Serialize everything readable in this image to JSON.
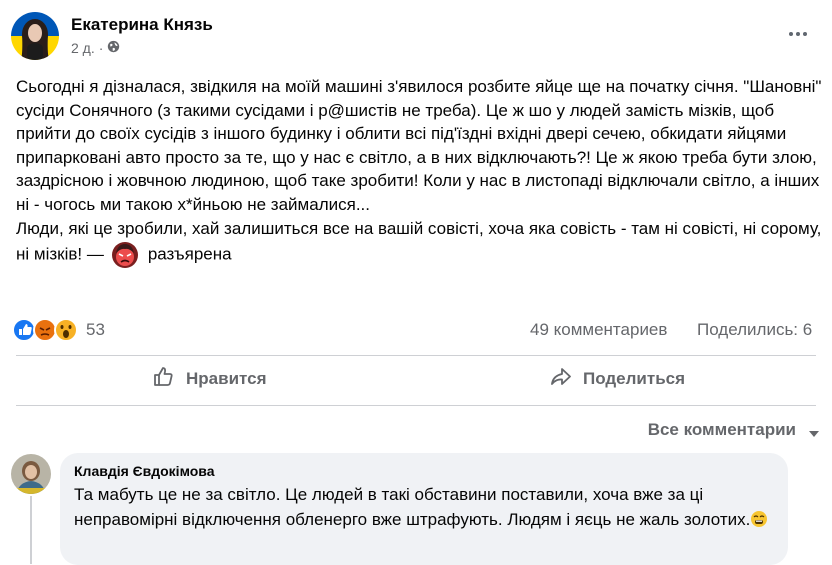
{
  "post": {
    "author": "Екатерина Князь",
    "time": "2 д.",
    "privacy_icon": "globe-icon",
    "more_icon": "more-options-icon",
    "paragraph_1": "Сьогодні я дізналася,  звідкиля на моїй машині з'явилося розбите яйце ще на початку січня. \"Шановні\" сусіди Сонячного (з такими сусідами і р@шистів не треба). Це ж шо у людей замість мізків, щоб прийти до своїх сусідів з іншого будинку і облити всі під'їздні вхідні двері сечею, обкидати яйцями припарковані авто просто за те, що у нас є світло, а в них відключають?! Це ж якою треба бути злою, заздрісною і жовчною людиною, щоб таке зробити! Коли у нас в листопаді відключали світло, а інших ні - чогось ми такою х*йньою не займалися...",
    "paragraph_2_main": "Люди, які це зробили, хай залишиться все на вашій совісті, хоча яка совість - там ні совісті, ні сорому, ні мізків! —",
    "feeling_icon": "angry-face-icon",
    "feeling": "разъярена"
  },
  "reactions": {
    "icons": [
      "like-reaction-icon",
      "angry-reaction-icon",
      "wow-reaction-icon"
    ],
    "count": "53",
    "comments": "49 комментариев",
    "shares": "Поделились: 6"
  },
  "actions": {
    "like_label": "Нравится",
    "like_icon": "thumbs-up-icon",
    "share_label": "Поделиться",
    "share_icon": "share-arrow-icon"
  },
  "comments_section": {
    "sort_label": "Все комментарии",
    "sort_icon": "caret-down-icon"
  },
  "comment": {
    "author": "Клавдія Євдокімова",
    "text": "Та мабуть це не за світло. Це людей в такі обставини поставили, хоча вже за ці неправомірні відключення обленерго вже штрафують. Людям і яєць не жаль золотих.",
    "emoji_icon": "weary-face-icon"
  },
  "colors": {
    "text_primary": "#050505",
    "text_secondary": "#65676b",
    "divider": "#ced0d4",
    "comment_bg": "#f0f2f5",
    "like_blue": "#1877f2",
    "angry_orange": "#e9710f",
    "wow_yellow": "#f7b125"
  }
}
